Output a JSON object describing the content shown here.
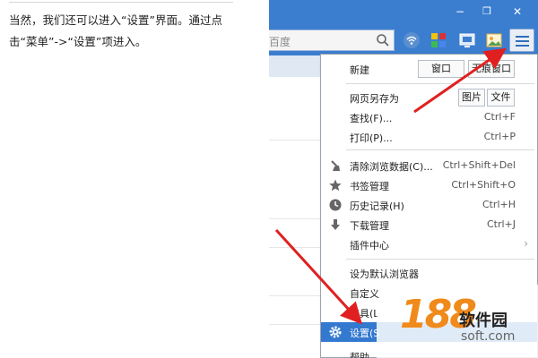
{
  "article": {
    "line1": "当然，我们还可以进入“设置”界面。通过点",
    "line2": "击“菜单”->“设置”项进入。"
  },
  "browser": {
    "window_controls": {
      "minimize": "−",
      "restore": "❐",
      "close": "✕"
    },
    "address_placeholder": "百度",
    "tab_label": "皮",
    "tab_close": "✕",
    "toolbar_icons": [
      "wifi-icon",
      "apps-icon",
      "screenshot-icon",
      "image-icon",
      "menu-icon"
    ]
  },
  "menu": {
    "new": {
      "label": "新建",
      "window_btn": "窗口",
      "incognito_btn": "无痕窗口"
    },
    "save_as": {
      "label": "网页另存为",
      "image_btn": "图片",
      "file_btn": "文件"
    },
    "find": {
      "label": "查找(F)...",
      "shortcut": "Ctrl+F"
    },
    "print": {
      "label": "打印(P)...",
      "shortcut": "Ctrl+P"
    },
    "clear": {
      "label": "清除浏览数据(C)...",
      "shortcut": "Ctrl+Shift+Del"
    },
    "bookmarks": {
      "label": "书签管理",
      "shortcut": "Ctrl+Shift+O"
    },
    "history": {
      "label": "历史记录(H)",
      "shortcut": "Ctrl+H"
    },
    "downloads": {
      "label": "下载管理",
      "shortcut": "Ctrl+J"
    },
    "plugins": {
      "label": "插件中心",
      "chevron": "›"
    },
    "set_default": {
      "label": "设为默认浏览器"
    },
    "customize": {
      "label": "自定义"
    },
    "tools": {
      "label": "工具(L"
    },
    "settings": {
      "label": "设置(S"
    },
    "help": {
      "label": "帮助"
    }
  },
  "watermark": {
    "number": "188",
    "name_cn": "软件园",
    "domain": "soft.com"
  },
  "colors": {
    "accent_blue": "#3b7ecf",
    "selected_item": "#3479d0",
    "arrow_red": "#e02020",
    "watermark_orange": "#f08a1a"
  }
}
